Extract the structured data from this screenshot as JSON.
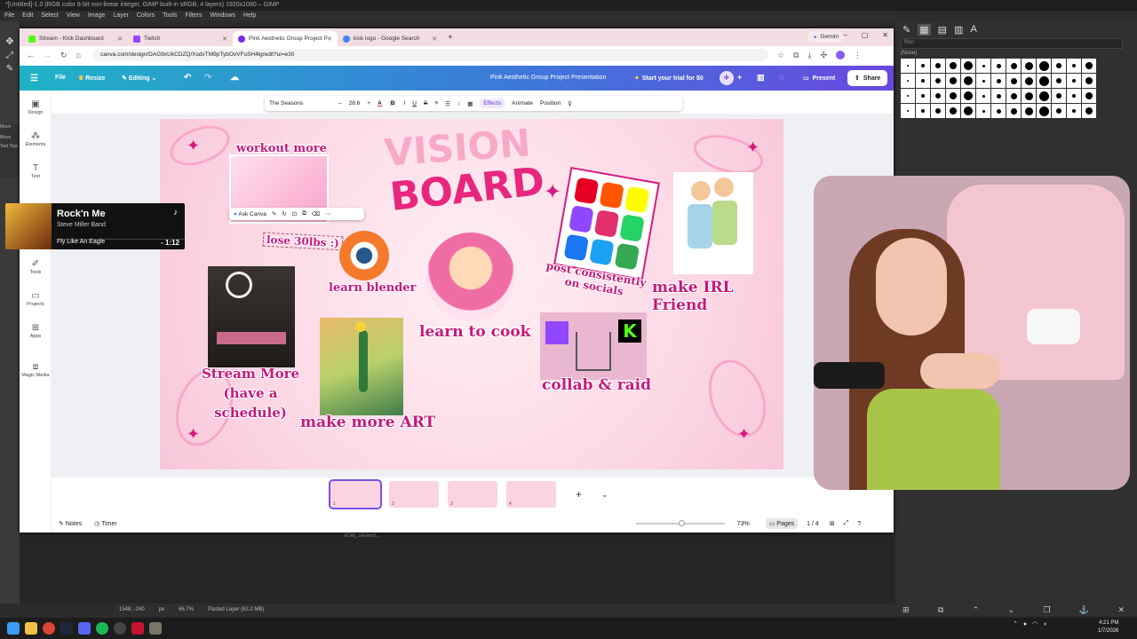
{
  "gimp": {
    "title": "*[Untitled]-1.0 (RGB color 8-bit non-linear integer, GIMP built-in sRGB, 4 layers) 1920x1080 – GIMP",
    "menus": [
      "File",
      "Edit",
      "Select",
      "View",
      "Image",
      "Layer",
      "Colors",
      "Tools",
      "Filters",
      "Windows",
      "Help"
    ],
    "layer_labels": [
      "Move",
      "Move",
      "Tool Tool"
    ],
    "status": {
      "coords": "1548, -240",
      "unit": "px",
      "zoom": "66.7%",
      "layer": "Pasted Layer (62.2 MB)"
    },
    "brush_filter_placeholder": "filter",
    "brush_name": "(None)",
    "canvas_note": "VC48_ cRulm03..."
  },
  "taskbar": {
    "time": "4:21 PM",
    "date": "1/7/2026"
  },
  "browser": {
    "tabs": [
      {
        "label": "Stream - Kick Dashboard",
        "color": "#53fc18",
        "active": false
      },
      {
        "label": "Twitch",
        "color": "#9146ff",
        "active": false
      },
      {
        "label": "Pink Aesthetic Group Project P",
        "color": "#7d2ae8",
        "active": true
      },
      {
        "label": "kick logo - Google Search",
        "color": "#4285f4",
        "active": false
      }
    ],
    "gemini_label": "Gemini",
    "url": "canva.com/design/DAG9xUkCDZQ/XsdvTM9pTybOvVFuSH4lg/edit?ui=e30"
  },
  "canva": {
    "header": {
      "file": "File",
      "resize": "Resize",
      "editing": "Editing",
      "doc_title": "Pink Aesthetic Group Project Presentation",
      "trial": "Start your trial for $0",
      "present": "Present",
      "share": "Share"
    },
    "rail": [
      "Design",
      "Elements",
      "Text",
      "Tools",
      "Projects",
      "Apps",
      "Magic Media"
    ],
    "toolbar": {
      "font": "The Seasons",
      "minus": "–",
      "size": "28.6",
      "plus": "+",
      "effects": "Effects",
      "animate": "Animate",
      "position": "Position"
    },
    "ask_canva": "Ask Canva",
    "slide": {
      "title_top": "VISION",
      "title_bottom": "BOARD",
      "goals": {
        "workout": "workout more",
        "lose": "lose 30lbs :)",
        "blender": "learn blender",
        "cook": "learn to cook",
        "socials": "post consistently on socials",
        "friend": "make IRL Friend",
        "stream": "Stream More (have a schedule)",
        "art": "make more ART",
        "collab": "collab & raid"
      }
    },
    "bottom": {
      "notes": "Notes",
      "timer": "Timer",
      "zoom": "73%",
      "pages": "Pages",
      "page_count": "1 / 4"
    },
    "thumbs": [
      "1",
      "2",
      "3",
      "4"
    ]
  },
  "music": {
    "title": "Rock'n Me",
    "artist": "Steve Miller Band",
    "album": "Fly Like An Eagle",
    "remaining": "- 1:12"
  }
}
